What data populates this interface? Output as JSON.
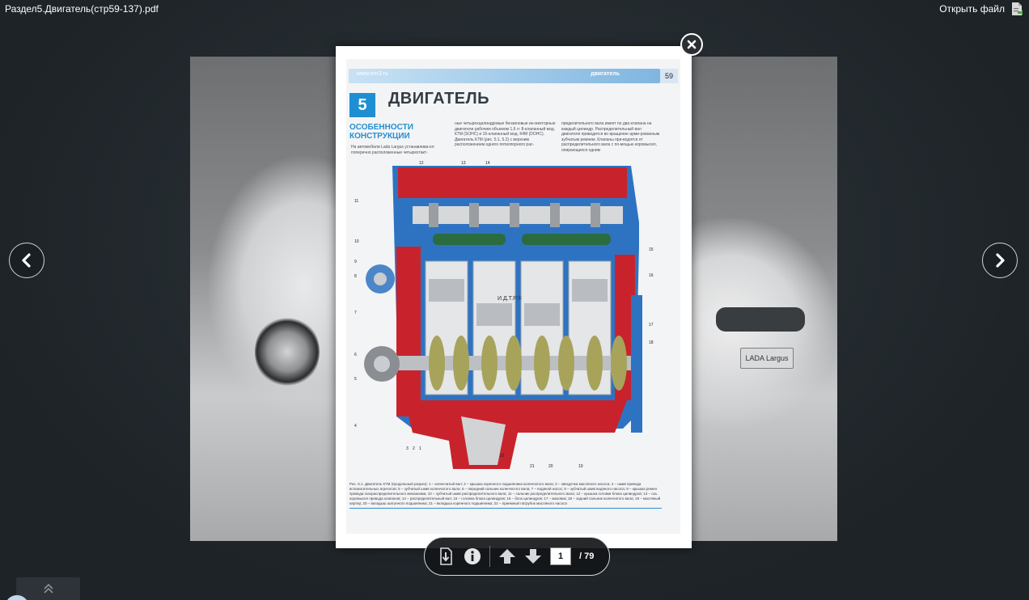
{
  "header": {
    "file_name": "Раздел5.Двигатель(стр59-137).pdf",
    "open_file_label": "Открыть файл"
  },
  "background": {
    "plate_text": "LADA Largus"
  },
  "page": {
    "site_url": "www.rim3.ru",
    "section_label": "двигатель",
    "page_number": "59",
    "chapter_number": "5",
    "chapter_title": "ДВИГАТЕЛЬ",
    "subtitle_line1": "ОСОБЕННОСТИ",
    "subtitle_line2": "КОНСТРУКЦИИ",
    "col1_text": "На автомобили Lada Largus устанавлива-ют поперечно расположенные четырехтакт-",
    "col2_text": "ные четырехцилиндровые бензиновые ин-жекторные двигатели рабочим объемом 1,6 л: 8-клапанный мод. К7М (SOHC) и 16-клапанный мод. К4М (DOHC). Двигатель К7М (рис. 5.1, 5.2) с верхним расположением одного пятиопорного рас-",
    "col3_text": "пределительного вала имеет по два клапана на каждый цилиндр. Распределительный вал двигателя приводится во вращение арми-рованным зубчатым ремнем. Клапаны при-водятся от распределительного вала с по-мощью коромысел, опирающихся одним",
    "watermark": "И.Д.Т.Р.®",
    "callouts": [
      "1",
      "2",
      "3",
      "4",
      "5",
      "6",
      "7",
      "8",
      "9",
      "10",
      "11",
      "12",
      "13",
      "14",
      "15",
      "16",
      "17",
      "18",
      "19",
      "20",
      "21",
      "22"
    ],
    "caption": "Рис. 5.1. Двигатель К7М (продольный разрез): 1 – коленчатый вал; 2 – крышка коренного подшипника коленчатого вала; 3 – звездочка масляного насоса; 4 – шкив привода вспомогательных агрегатов; 5 – зубчатый шкив коленчатого вала; 6 – передний сальник коленчатого вала; 7 – водяной насос; 8 – зубчатый шкив водяного насоса; 9 – крышка ремня привода газораспределительного механизма; 10 – зубчатый шкив распределительного вала; 11 – сальник распределительного вала; 12 – крышка головки блока цилиндров; 13 – ось коромысел привода клапанов; 14 – распределительный вал; 15 – головка блока цилиндров; 16 – блок цилиндров; 17 – маховик; 18 – задний сальник коленчатого вала; 19 – масляный картер; 20 – вкладыш шатунного подшипника; 21 – вкладыш коренного подшипника; 22 – приемный патрубок масляного насоса"
  },
  "toolbar": {
    "current_page": "1",
    "total_pages": "/ 79"
  },
  "icons": {
    "download": "download-icon",
    "info": "info-icon",
    "up": "arrow-up-icon",
    "down": "arrow-down-icon",
    "close": "close-icon",
    "prev": "chevron-left-icon",
    "next": "chevron-right-icon"
  }
}
